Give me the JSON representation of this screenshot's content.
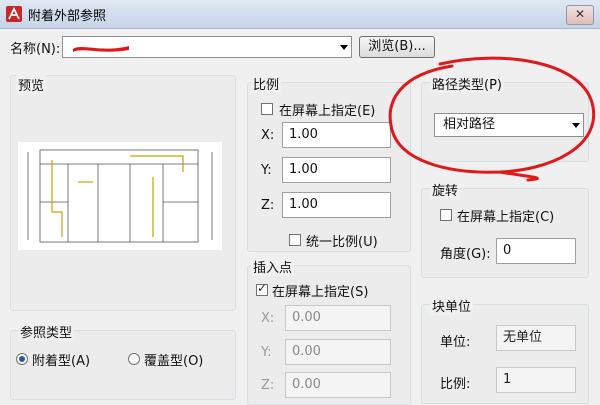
{
  "window": {
    "title": "附着外部参照",
    "close_glyph": "✕"
  },
  "name_row": {
    "label": "名称(N):",
    "browse_label": "浏览(B)..."
  },
  "preview": {
    "title": "预览"
  },
  "scale": {
    "title": "比例",
    "onscreen_label": "在屏幕上指定(E)",
    "onscreen_checked": false,
    "x_label": "X:",
    "x_value": "1.00",
    "y_label": "Y:",
    "y_value": "1.00",
    "z_label": "Z:",
    "z_value": "1.00",
    "uniform_label": "统一比例(U)",
    "uniform_checked": false
  },
  "path": {
    "title": "路径类型(P)",
    "selected": "相对路径"
  },
  "rotation": {
    "title": "旋转",
    "onscreen_label": "在屏幕上指定(C)",
    "angle_label": "角度(G):",
    "angle_value": "0"
  },
  "insertion": {
    "title": "插入点",
    "onscreen_label": "在屏幕上指定(S)",
    "onscreen_checked": true,
    "x_label": "X:",
    "x_value": "0.00",
    "y_label": "Y:",
    "y_value": "0.00",
    "z_label": "Z:",
    "z_value": "0.00"
  },
  "block_unit": {
    "title": "块单位",
    "unit_label": "单位:",
    "unit_value": "无单位",
    "scale_label": "比例:",
    "scale_value": "1"
  },
  "ref_type": {
    "title": "参照类型",
    "attach_label": "附着型(A)",
    "overlay_label": "覆盖型(O)",
    "selected": "attach"
  },
  "colors": {
    "annotation_red": "#e0181b",
    "title_gradient_top": "#dfe8f3"
  }
}
